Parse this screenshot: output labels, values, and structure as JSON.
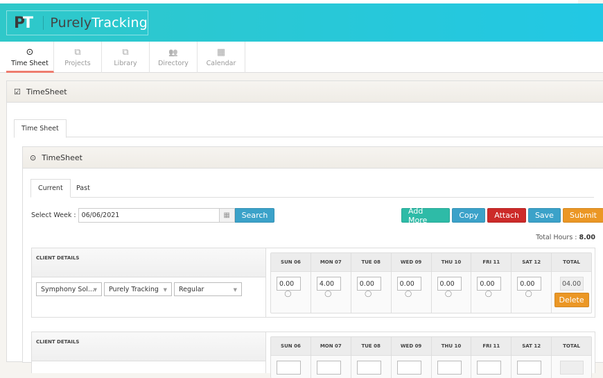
{
  "brand": {
    "mark_p": "P",
    "mark_t": "T",
    "name_a": "Purely",
    "name_b": "Tracking"
  },
  "nav": [
    {
      "label": "Time Sheet",
      "icon": "clock-icon",
      "glyph": "⊙",
      "active": true
    },
    {
      "label": "Projects",
      "icon": "copy-icon",
      "glyph": "⧉"
    },
    {
      "label": "Library",
      "icon": "copy-icon",
      "glyph": "⧉"
    },
    {
      "label": "Directory",
      "icon": "users-icon",
      "glyph": "👥"
    },
    {
      "label": "Calendar",
      "icon": "calendar-icon",
      "glyph": "▦"
    }
  ],
  "panel": {
    "title": "TimeSheet",
    "icon_glyph": "☑"
  },
  "outer_tab": "Time Sheet",
  "inner": {
    "title": "TimeSheet",
    "icon_glyph": "⊙"
  },
  "tabs": [
    {
      "label": "Current",
      "active": true
    },
    {
      "label": "Past"
    }
  ],
  "week": {
    "label": "Select Week :",
    "value": "06/06/2021",
    "cal_glyph": "▦",
    "search_label": "Search"
  },
  "actions": {
    "add_more": "Add More",
    "copy": "Copy",
    "attach": "Attach",
    "save": "Save",
    "submit": "Submit"
  },
  "total_hours": {
    "label": "Total Hours :",
    "value": "8.00"
  },
  "client_header": "CLIENT DETAILS",
  "day_headers": [
    "SUN 06",
    "MON 07",
    "TUE 08",
    "WED 09",
    "THU 10",
    "FRI 11",
    "SAT 12"
  ],
  "total_header": "TOTAL",
  "rows": [
    {
      "client": "Symphony Sol...",
      "project": "Purely Tracking",
      "type": "Regular",
      "hours": [
        "0.00",
        "4.00",
        "0.00",
        "0.00",
        "0.00",
        "0.00",
        "0.00"
      ],
      "total": "04.00",
      "delete": "Delete"
    }
  ],
  "comment_glyph": "💬",
  "caret_glyph": "▼"
}
